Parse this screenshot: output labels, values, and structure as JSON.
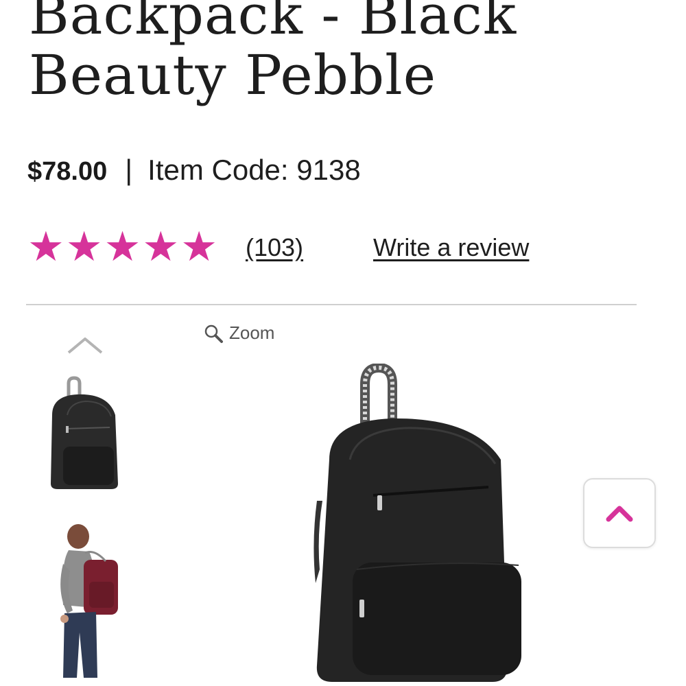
{
  "product": {
    "title_line1": "Backpack - Black",
    "title_line2": "Beauty Pebble",
    "price": "$78.00",
    "separator": "|",
    "item_code": "Item Code: 9138"
  },
  "rating": {
    "stars": 5,
    "max_stars": 5,
    "count": "(103)",
    "write_review": "Write a review"
  },
  "gallery": {
    "zoom_label": "Zoom",
    "zoom_icon": "magnifier-icon",
    "prev_icon": "chevron-up-icon",
    "thumbnails": [
      "backpack-black-thumbnail",
      "backpack-worn-thumbnail"
    ],
    "main_image": "backpack-black-main"
  },
  "back_to_top": {
    "icon": "chevron-up-icon"
  },
  "colors": {
    "accent": "#d6339a",
    "divider": "#cfcfcf",
    "text": "#1e1e1e"
  }
}
